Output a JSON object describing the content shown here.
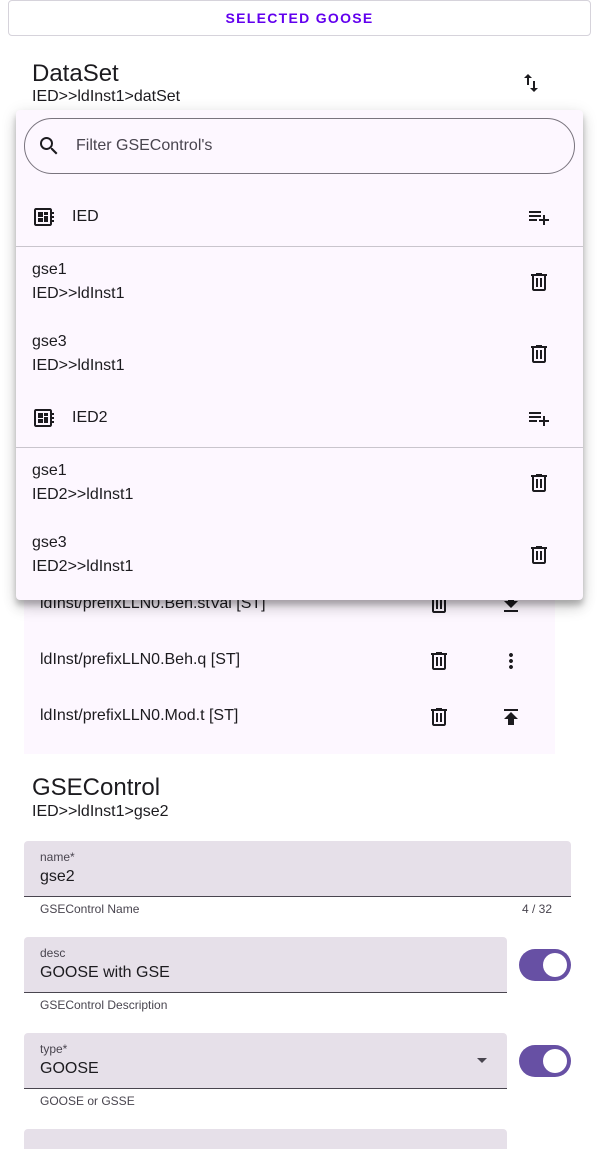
{
  "top_button": {
    "label": "SELECTED GOOSE"
  },
  "dataset": {
    "title": "DataSet",
    "path": "IED>>ldInst1>datSet"
  },
  "fcda_items": [
    {
      "label": "ldInst/prefixLLN0.Beh.stVal [ST]",
      "action_icon": "download-icon"
    },
    {
      "label": "ldInst/prefixLLN0.Beh.q [ST]",
      "action_icon": "more-vert-icon"
    },
    {
      "label": "ldInst/prefixLLN0.Mod.t [ST]",
      "action_icon": "upload-icon"
    }
  ],
  "menu": {
    "search_placeholder": "Filter GSEControl's",
    "groups": [
      {
        "ied": "IED",
        "items": [
          {
            "name": "gse1",
            "path": "IED>>ldInst1"
          },
          {
            "name": "gse3",
            "path": "IED>>ldInst1"
          }
        ]
      },
      {
        "ied": "IED2",
        "items": [
          {
            "name": "gse1",
            "path": "IED2>>ldInst1"
          },
          {
            "name": "gse3",
            "path": "IED2>>ldInst1"
          }
        ]
      }
    ]
  },
  "gsecontrol": {
    "title": "GSEControl",
    "path": "IED>>ldInst1>gse2",
    "fields": {
      "name": {
        "label": "name*",
        "value": "gse2",
        "helper": "GSEControl Name",
        "counter": "4 / 32"
      },
      "desc": {
        "label": "desc",
        "value": "GOOSE with GSE",
        "helper": "GSEControl Description",
        "toggle_on": true
      },
      "type": {
        "label": "type*",
        "value": "GOOSE",
        "helper": "GOOSE or GSSE",
        "toggle_on": true
      }
    }
  },
  "colors": {
    "primary": "#6200ee",
    "switch_track": "#6750a4",
    "surface": "#fdf7ff",
    "field_bg": "#e6e0e9"
  }
}
